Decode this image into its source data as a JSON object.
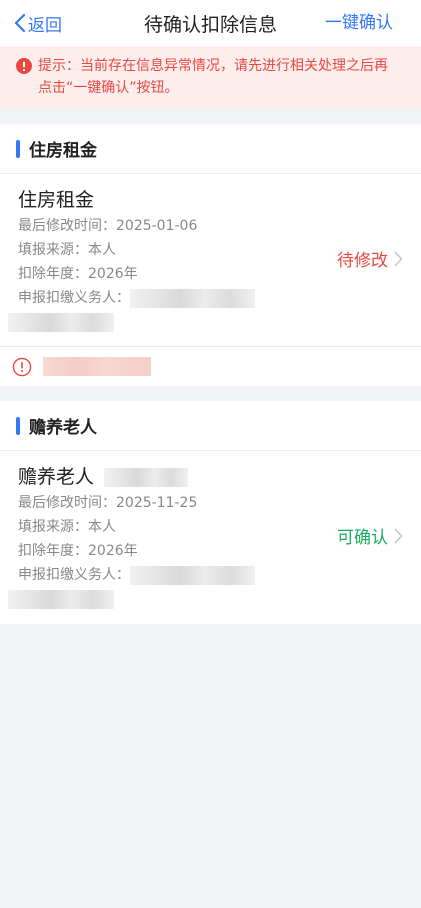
{
  "nav": {
    "back_label": "返回",
    "title": "待确认扣除信息",
    "confirm_all_label": "一键确认"
  },
  "notice": {
    "text": "提示：当前存在信息异常情况，请先进行相关处理之后再点击“一键确认”按钮。"
  },
  "sections": [
    {
      "header": "住房租金",
      "card": {
        "title": "住房租金",
        "modified_label": "最后修改时间：",
        "modified_value": "2025-01-06",
        "source_label": "填报来源：",
        "source_value": "本人",
        "year_label": "扣除年度：",
        "year_value": "2026年",
        "agent_label": "申报扣缴义务人：",
        "status": "待修改",
        "status_color": "#e64942"
      }
    },
    {
      "header": "赡养老人",
      "card": {
        "title": "赡养老人",
        "modified_label": "最后修改时间：",
        "modified_value": "2025-11-25",
        "source_label": "填报来源：",
        "source_value": "本人",
        "year_label": "扣除年度：",
        "year_value": "2026年",
        "agent_label": "申报扣缴义务人：",
        "status": "可确认",
        "status_color": "#1aad62"
      }
    }
  ],
  "colors": {
    "accent": "#3478f6",
    "error": "#e64942",
    "success": "#1aad62"
  },
  "icons": [
    "back-chevron-icon",
    "warning-icon",
    "chevron-right-icon",
    "alert-circle-icon"
  ]
}
